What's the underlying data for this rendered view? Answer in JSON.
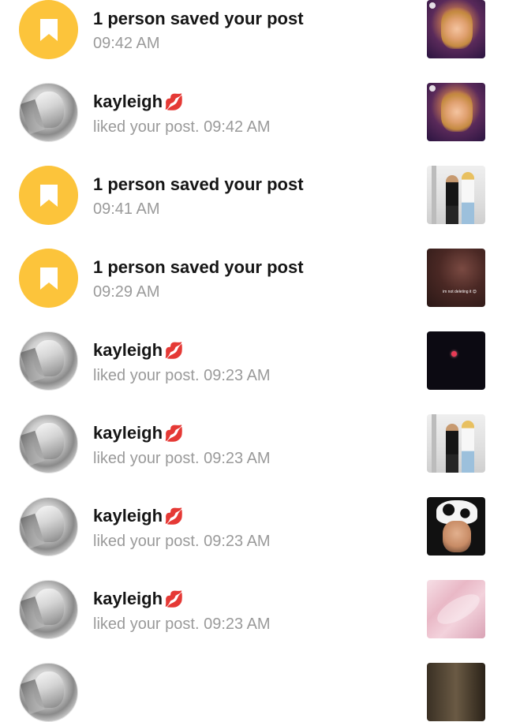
{
  "notifications": [
    {
      "type": "saved",
      "title": "1 person saved your post",
      "subtitle": "09:42 AM",
      "thumb": "stage"
    },
    {
      "type": "like",
      "name": "kayleigh",
      "emoji": "💋",
      "subtitle": "liked your post. 09:42 AM",
      "thumb": "stage"
    },
    {
      "type": "saved",
      "title": "1 person saved your post",
      "subtitle": "09:41 AM",
      "thumb": "duo"
    },
    {
      "type": "saved",
      "title": "1 person saved your post",
      "subtitle": "09:29 AM",
      "thumb": "dark-brown",
      "thumb_caption": "im not deleting it 😌"
    },
    {
      "type": "like",
      "name": "kayleigh",
      "emoji": "💋",
      "subtitle": "liked your post. 09:23 AM",
      "thumb": "black"
    },
    {
      "type": "like",
      "name": "kayleigh",
      "emoji": "💋",
      "subtitle": "liked your post. 09:23 AM",
      "thumb": "duo"
    },
    {
      "type": "like",
      "name": "kayleigh",
      "emoji": "💋",
      "subtitle": "liked your post. 09:23 AM",
      "thumb": "cow"
    },
    {
      "type": "like",
      "name": "kayleigh",
      "emoji": "💋",
      "subtitle": "liked your post. 09:23 AM",
      "thumb": "pink"
    }
  ],
  "icons": {
    "saved_avatar": "bookmark-icon",
    "saved_avatar_color": "#fcc43b"
  }
}
